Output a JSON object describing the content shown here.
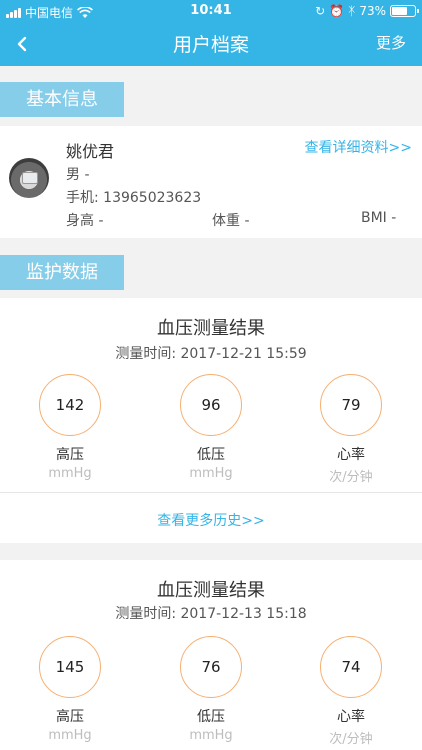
{
  "status_bar": {
    "carrier": "中国电信",
    "time": "10:41",
    "battery_percent": "73%",
    "battery_level": 0.73
  },
  "nav": {
    "title": "用户档案",
    "more_label": "更多"
  },
  "basic_info": {
    "section_label": "基本信息",
    "name": "姚优君",
    "detail_link": "查看详细资料>>",
    "gender": "男 -",
    "phone": "手机: 13965023623",
    "height": "身高 -",
    "weight": "体重 -",
    "bmi": "BMI -"
  },
  "monitor": {
    "section_label": "监护数据",
    "records": [
      {
        "title": "血压测量结果",
        "time": "测量时间: 2017-12-21 15:59",
        "metrics": [
          {
            "value": "142",
            "label": "高压",
            "unit": "mmHg"
          },
          {
            "value": "96",
            "label": "低压",
            "unit": "mmHg"
          },
          {
            "value": "79",
            "label": "心率",
            "unit": "次/分钟"
          }
        ],
        "history_link": "查看更多历史>>"
      },
      {
        "title": "血压测量结果",
        "time": "测量时间: 2017-12-13 15:18",
        "metrics": [
          {
            "value": "145",
            "label": "高压",
            "unit": "mmHg"
          },
          {
            "value": "76",
            "label": "低压",
            "unit": "mmHg"
          },
          {
            "value": "74",
            "label": "心率",
            "unit": "次/分钟"
          }
        ]
      }
    ]
  },
  "colors": {
    "header_bg": "#35b4e6",
    "section_label_bg": "#86cde9",
    "circle_border": "#f6b073",
    "link": "#35b4e6"
  }
}
